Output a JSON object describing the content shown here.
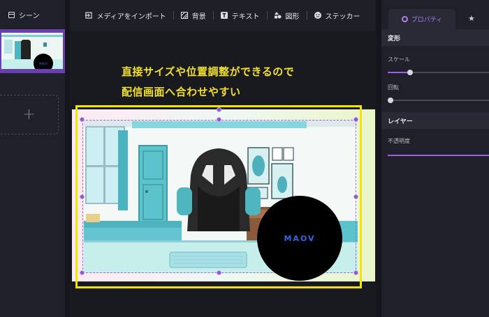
{
  "left_panel": {
    "title": "シーン",
    "add_label": "+"
  },
  "toolbar": {
    "items": [
      {
        "label": "メディアをインポート",
        "icon": "import-icon"
      },
      {
        "label": "背景",
        "icon": "background-icon"
      },
      {
        "label": "テキスト",
        "icon": "text-icon"
      },
      {
        "label": "図形",
        "icon": "shapes-icon"
      },
      {
        "label": "ステッカー",
        "icon": "sticker-icon"
      }
    ]
  },
  "canvas": {
    "caption_line1": "直接サイズや位置調整ができるので",
    "caption_line2": "配信画面へ合わせやすい",
    "logo_text": "MAOV",
    "caption_color": "#f2e02a",
    "frame_color": "#f2e500"
  },
  "right_panel": {
    "tab_properties": "プロパティ",
    "tab_second_icon": "star-icon",
    "section_transform": "変形",
    "scale_label": "スケール",
    "scale_value": 0.22,
    "rotation_label": "回転",
    "rotation_value": 0.03,
    "section_layer": "レイヤー",
    "opacity_label": "不透明度",
    "opacity_value": 1.0,
    "accent_color": "#b07ef0"
  }
}
